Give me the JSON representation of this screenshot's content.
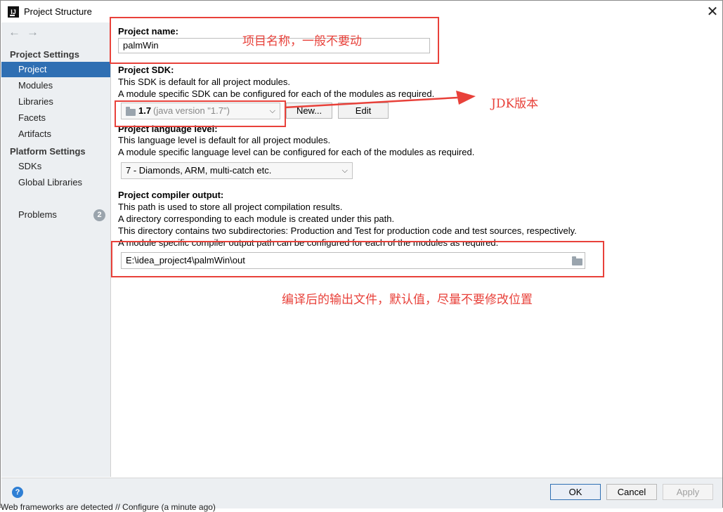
{
  "window": {
    "title": "Project Structure",
    "close_glyph": "✕"
  },
  "nav": {
    "back": "←",
    "forward": "→"
  },
  "sidebar": {
    "section_project_settings": "Project Settings",
    "items_project": [
      "Project",
      "Modules",
      "Libraries",
      "Facets",
      "Artifacts"
    ],
    "section_platform_settings": "Platform Settings",
    "items_platform": [
      "SDKs",
      "Global Libraries"
    ],
    "problems": {
      "label": "Problems",
      "count": "2"
    }
  },
  "project_name": {
    "label": "Project name:",
    "value": "palmWin"
  },
  "sdk": {
    "label": "Project SDK:",
    "desc1": "This SDK is default for all project modules.",
    "desc2": "A module specific SDK can be configured for each of the modules as required.",
    "selected_version": "1.7",
    "selected_detail": "(java version \"1.7\")",
    "new_button": "New...",
    "edit_button": "Edit"
  },
  "language_level": {
    "label": "Project language level:",
    "desc1": "This language level is default for all project modules.",
    "desc2": "A module specific language level can be configured for each of the modules as required.",
    "selected": "7 - Diamonds, ARM, multi-catch etc."
  },
  "compiler_output": {
    "label": "Project compiler output:",
    "desc1": "This path is used to store all project compilation results.",
    "desc2": "A directory corresponding to each module is created under this path.",
    "desc3": "This directory contains two subdirectories: Production and Test for production code and test sources, respectively.",
    "desc4": "A module specific compiler output path can be configured for each of the modules as required.",
    "path": "E:\\idea_project4\\palmWin\\out"
  },
  "annotations": {
    "name_note": "项目名称，一般不要动",
    "jdk_note": "JDK版本",
    "output_note": "编译后的输出文件，默认值，尽量不要修改位置",
    "accent_color": "#e8413a"
  },
  "footer": {
    "help": "?",
    "ok": "OK",
    "cancel": "Cancel",
    "apply": "Apply",
    "status": "Web frameworks are detected // Configure (a minute ago)"
  },
  "colors": {
    "selection": "#2f6fb3",
    "sidebar_bg": "#eceff2"
  }
}
